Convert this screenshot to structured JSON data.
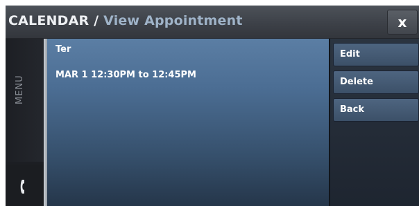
{
  "titlebar": {
    "app_name": "CALENDAR",
    "separator": "/",
    "screen_title": "View Appointment",
    "close_label": "x"
  },
  "sidebar": {
    "menu_label": "MENU",
    "phone_icon": "phone-icon"
  },
  "appointment": {
    "name": "Ter",
    "time": "MAR 1 12:30PM to 12:45PM"
  },
  "actions": {
    "edit_label": "Edit",
    "delete_label": "Delete",
    "back_label": "Back"
  },
  "colors": {
    "accent_blue": "#4b6d93",
    "button_blue": "#4e6580",
    "subtitle": "#9fb3c8"
  }
}
